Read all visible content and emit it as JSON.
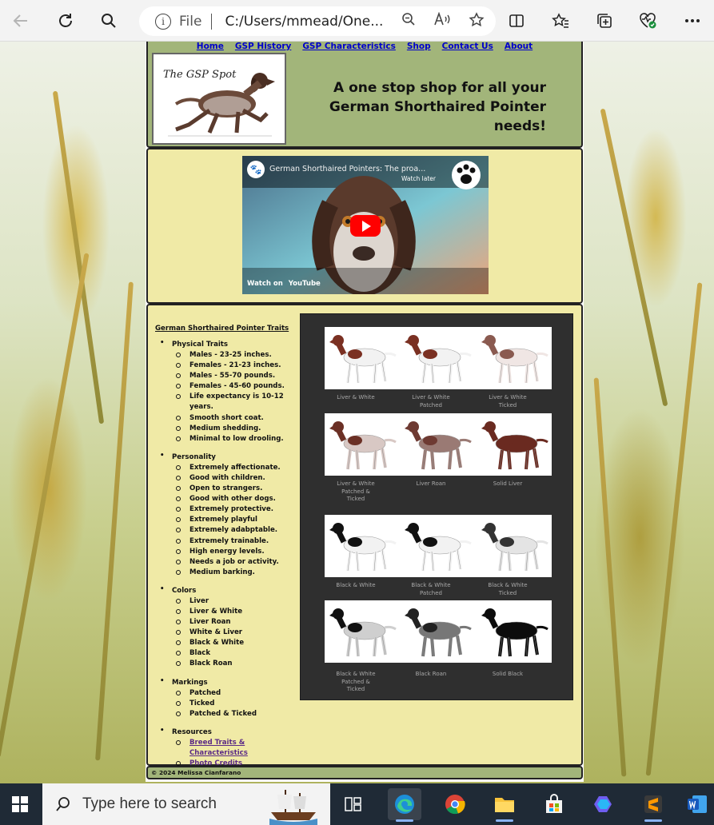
{
  "browser": {
    "file_label": "File",
    "url": "C:/Users/mmead/One...",
    "icons": {
      "back": "back-arrow-icon",
      "refresh": "refresh-icon",
      "search": "search-icon",
      "info": "info-icon",
      "zoom_out": "zoom-out-icon",
      "read_aloud": "read-aloud-icon",
      "favorite": "star-icon",
      "split": "split-screen-icon",
      "favorites": "favorites-icon",
      "collections": "collections-icon",
      "health": "browser-essentials-icon",
      "more": "more-icon"
    }
  },
  "site": {
    "nav": [
      "Home",
      "GSP History",
      "GSP Characteristics",
      "Shop",
      "Contact Us",
      "About"
    ],
    "logo_text": "The GSP Spot",
    "tagline_line1": "A one stop shop for all your",
    "tagline_line2": "German Shorthaired Pointer needs!",
    "colors": {
      "header_green": "#a2b57a",
      "panel_cream": "#f0eaa6",
      "link_blue": "#0000cc",
      "visited_purple": "#5b2a86"
    }
  },
  "video": {
    "title": "German Shorthaired Pointers: The proa...",
    "watch_later": "Watch later",
    "watch_on": "Watch on",
    "platform": "YouTube"
  },
  "traits": {
    "heading": "German Shorthaired Pointer Traits",
    "sections": [
      {
        "title": "Physical Traits",
        "items": [
          "Males - 23-25 inches.",
          "Females - 21-23 inches.",
          "Males - 55-70 pounds.",
          "Females - 45-60 pounds.",
          "Life expectancy is 10-12 years.",
          "Smooth short coat.",
          "Medium shedding.",
          "Minimal to low drooling."
        ]
      },
      {
        "title": "Personality",
        "items": [
          "Extremely affectionate.",
          "Good with children.",
          "Open to strangers.",
          "Good with other dogs.",
          "Extremely protective.",
          "Extremely playful",
          "Extremely adabptable.",
          "Extremely trainable.",
          "High energy levels.",
          "Needs a job or activity.",
          "Medium barking."
        ]
      },
      {
        "title": "Colors",
        "items": [
          "Liver",
          "Liver & White",
          "Liver Roan",
          "White & Liver",
          "Black & White",
          "Black",
          "Black Roan"
        ]
      },
      {
        "title": "Markings",
        "items": [
          "Patched",
          "Ticked",
          "Patched & Ticked"
        ]
      }
    ],
    "resources_title": "Resources",
    "resources": [
      "Breed Traits & Characteristics",
      "Photo Credits"
    ]
  },
  "color_chart": {
    "captions": [
      [
        "Liver & White",
        "Liver & White\nPatched",
        "Liver & White\nTicked"
      ],
      [
        "Liver & White\nPatched &\nTicked",
        "Liver Roan",
        "Solid Liver"
      ],
      [
        "Black & White",
        "Black & White\nPatched",
        "Black & White\nTicked"
      ],
      [
        "Black & White\nPatched &\nTicked",
        "Black Roan",
        "Solid Black"
      ]
    ]
  },
  "footer": {
    "text": "© 2024 Melissa Cianfarano"
  },
  "taskbar": {
    "search_placeholder": "Type here to search",
    "apps": [
      "task-view-icon",
      "edge-icon",
      "chrome-icon",
      "file-explorer-icon",
      "store-icon",
      "copilot-icon",
      "sublime-icon",
      "word-icon"
    ]
  }
}
